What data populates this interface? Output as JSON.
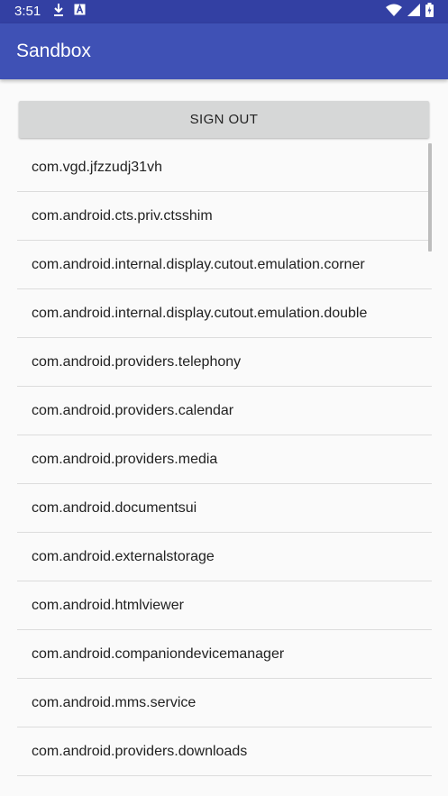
{
  "status_bar": {
    "time": "3:51",
    "left_icons": [
      "download-icon",
      "a-badge-icon"
    ],
    "right_icons": [
      "wifi-icon",
      "signal-icon",
      "battery-icon"
    ]
  },
  "app_bar": {
    "title": "Sandbox"
  },
  "sign_out": {
    "label": "SIGN OUT"
  },
  "packages": [
    "com.vgd.jfzzudj31vh",
    "com.android.cts.priv.ctsshim",
    "com.android.internal.display.cutout.emulation.corner",
    "com.android.internal.display.cutout.emulation.double",
    "com.android.providers.telephony",
    "com.android.providers.calendar",
    "com.android.providers.media",
    "com.android.documentsui",
    "com.android.externalstorage",
    "com.android.htmlviewer",
    "com.android.companiondevicemanager",
    "com.android.mms.service",
    "com.android.providers.downloads"
  ],
  "colors": {
    "status_bar": "#3340a3",
    "app_bar": "#3f51b5",
    "button": "#d6d7d7",
    "background": "#fafafa",
    "divider": "#dcdcdc"
  }
}
